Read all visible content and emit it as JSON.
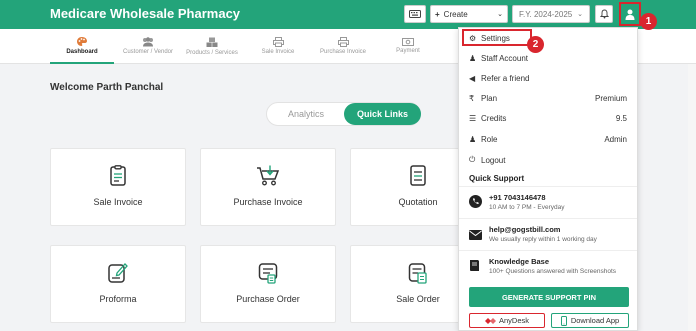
{
  "app": {
    "title": "Medicare Wholesale Pharmacy"
  },
  "header": {
    "create_label": "Create",
    "fy_label": "F.Y. 2024-2025"
  },
  "nav": {
    "tabs": [
      {
        "label": "Dashboard",
        "icon": "palette-icon"
      },
      {
        "label": "Customer / Vendor",
        "icon": "users-icon"
      },
      {
        "label": "Products / Services",
        "icon": "boxes-icon"
      },
      {
        "label": "Sale Invoice",
        "icon": "printer-icon"
      },
      {
        "label": "Purchase Invoice",
        "icon": "printer-icon"
      },
      {
        "label": "Payment",
        "icon": "cash-icon"
      }
    ]
  },
  "main": {
    "welcome": "Welcome Parth Panchal",
    "toggle": {
      "analytics": "Analytics",
      "quick_links": "Quick Links"
    },
    "cards": [
      {
        "label": "Sale Invoice",
        "icon": "invoice-icon"
      },
      {
        "label": "Purchase Invoice",
        "icon": "cart-icon"
      },
      {
        "label": "Quotation",
        "icon": "document-icon"
      },
      {
        "label": "Proforma",
        "icon": "edit-doc-icon"
      },
      {
        "label": "Purchase Order",
        "icon": "order-icon"
      },
      {
        "label": "Sale Order",
        "icon": "clipboard-icon"
      }
    ]
  },
  "dropdown": {
    "items": [
      {
        "label": "Settings",
        "icon": "gear-icon",
        "value": ""
      },
      {
        "label": "Staff Account",
        "icon": "staff-icon",
        "value": ""
      },
      {
        "label": "Refer a friend",
        "icon": "megaphone-icon",
        "value": ""
      },
      {
        "label": "Plan",
        "icon": "rupee-icon",
        "value": "Premium"
      },
      {
        "label": "Credits",
        "icon": "database-icon",
        "value": "9.5"
      },
      {
        "label": "Role",
        "icon": "person-icon",
        "value": "Admin"
      },
      {
        "label": "Logout",
        "icon": "power-icon",
        "value": ""
      }
    ],
    "quick_support_title": "Quick Support",
    "support": [
      {
        "title": "+91 7043146478",
        "sub": "10 AM to 7 PM - Everyday",
        "icon": "phone-icon"
      },
      {
        "title": "help@gogstbill.com",
        "sub": "We usually reply within 1 working day",
        "icon": "mail-icon"
      },
      {
        "title": "Knowledge Base",
        "sub": "100+ Questions answered with Screenshots",
        "icon": "book-icon"
      }
    ],
    "generate_pin": "GENERATE SUPPORT PIN",
    "anydesk": "AnyDesk",
    "download_app": "Download App"
  },
  "annotations": {
    "marker_1": "1",
    "marker_2": "2"
  },
  "colors": {
    "brand": "#23a47a",
    "highlight": "#d9262e"
  }
}
